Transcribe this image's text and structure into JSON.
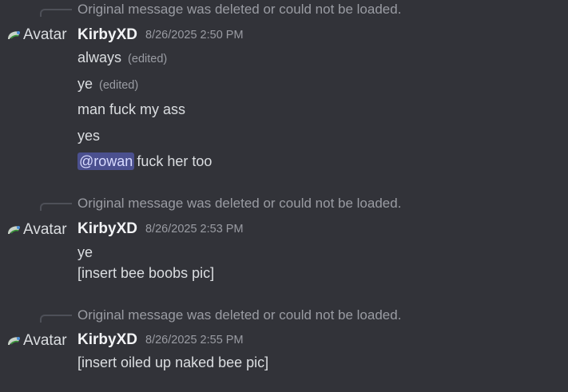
{
  "groups": [
    {
      "reply_notice": "Original message was deleted or could not be loaded.",
      "avatar_alt": "Avatar",
      "username": "KirbyXD",
      "timestamp": "8/26/2025 2:50 PM",
      "messages": [
        {
          "text": "always",
          "edited": "(edited)"
        },
        {
          "text": "ye",
          "edited": "(edited)"
        },
        {
          "text": "man fuck my ass"
        },
        {
          "text": "yes"
        },
        {
          "mention": "@rowan",
          "text": "fuck her too"
        }
      ]
    },
    {
      "reply_notice": "Original message was deleted or could not be loaded.",
      "avatar_alt": "Avatar",
      "username": "KirbyXD",
      "timestamp": "8/26/2025 2:53 PM",
      "messages": [
        {
          "text": "ye"
        },
        {
          "text": "[insert bee boobs pic]"
        }
      ]
    },
    {
      "reply_notice": "Original message was deleted or could not be loaded.",
      "avatar_alt": "Avatar",
      "username": "KirbyXD",
      "timestamp": "8/26/2025 2:55 PM",
      "messages": [
        {
          "text": "[insert oiled up naked bee pic]"
        }
      ]
    }
  ],
  "colors": {
    "background": "#323339",
    "mention_bg": "#4b508f",
    "username": "#f2f3f5",
    "muted": "#9a9ca3"
  },
  "icons": {
    "avatar": "broken-image-icon"
  }
}
